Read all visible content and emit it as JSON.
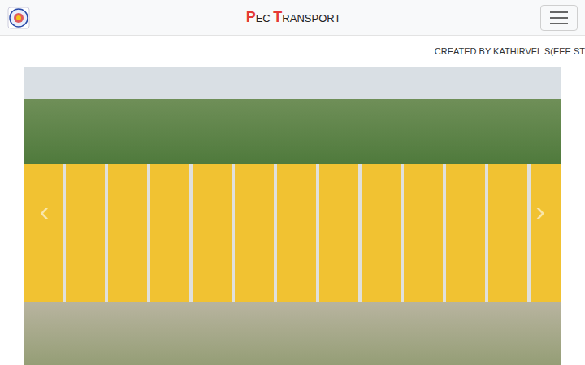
{
  "navbar": {
    "brand": [
      {
        "text": "P",
        "accent": true
      },
      {
        "text": "EC ",
        "accent": false
      },
      {
        "text": "T",
        "accent": true
      },
      {
        "text": "RANSPORT",
        "accent": false
      }
    ],
    "menu_expanded": false
  },
  "marquee": {
    "text": "CREATED BY KATHIRVEL S(EEE ST"
  },
  "carousel": {
    "prev": "‹",
    "next": "›"
  }
}
